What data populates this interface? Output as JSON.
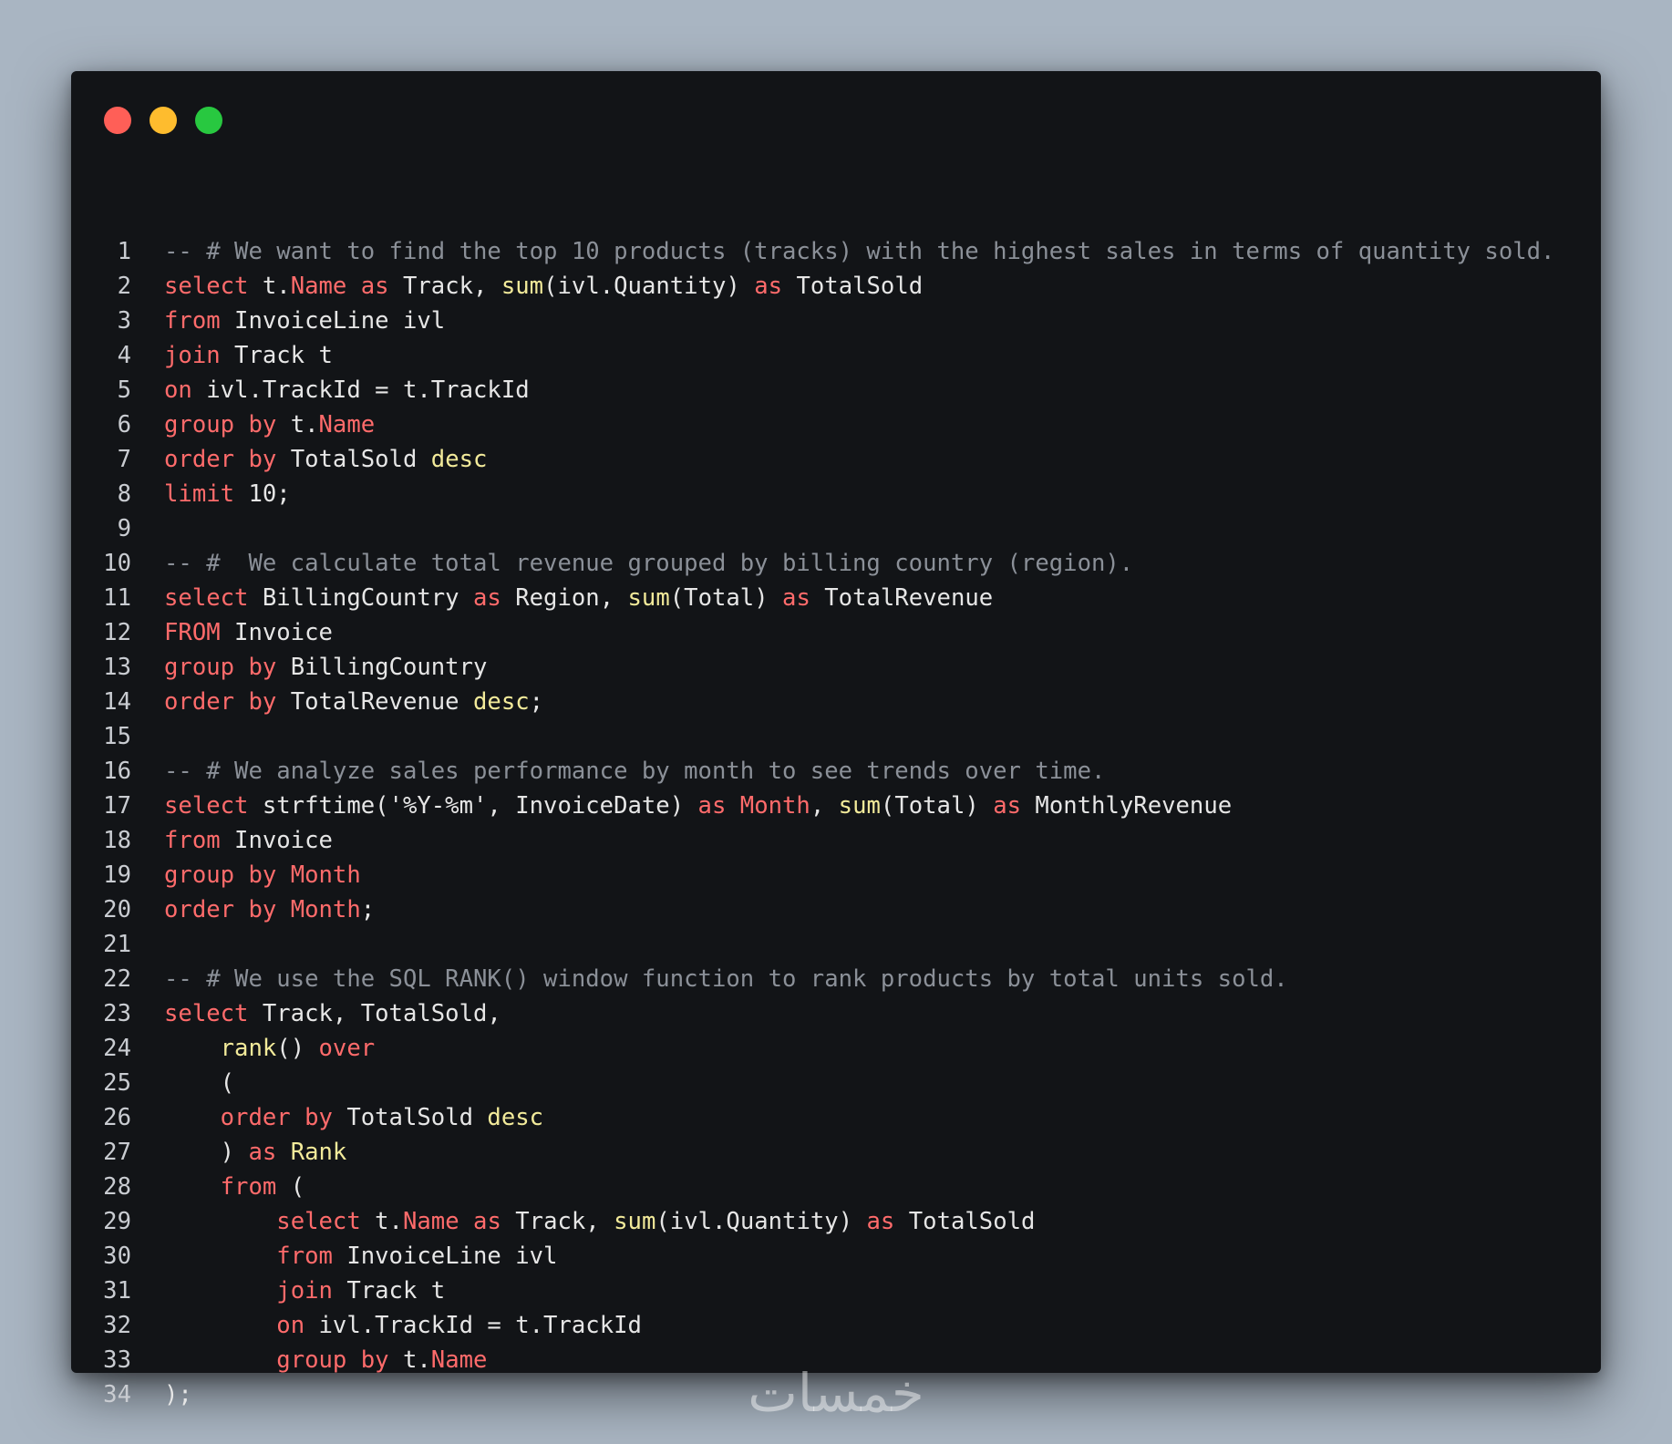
{
  "window": {
    "controls": [
      "close",
      "minimize",
      "maximize"
    ],
    "colors": {
      "close": "#ff5f57",
      "minimize": "#febc2e",
      "maximize": "#28c840",
      "background": "#121417",
      "keyword": "#ff6b6b",
      "function": "#f2ea9a",
      "comment": "#8b9098"
    }
  },
  "code": {
    "language": "sql",
    "lines": [
      [
        [
          "c",
          "-- # We want to find the top 10 products (tracks) with the highest sales in terms of quantity sold."
        ]
      ],
      [
        [
          "k",
          "select"
        ],
        [
          "s",
          " t."
        ],
        [
          "k",
          "Name"
        ],
        [
          "s",
          " "
        ],
        [
          "k",
          "as"
        ],
        [
          "s",
          " Track, "
        ],
        [
          "f",
          "sum"
        ],
        [
          "s",
          "(ivl.Quantity) "
        ],
        [
          "k",
          "as"
        ],
        [
          "s",
          " TotalSold"
        ]
      ],
      [
        [
          "k",
          "from"
        ],
        [
          "s",
          " InvoiceLine ivl"
        ]
      ],
      [
        [
          "k",
          "join"
        ],
        [
          "s",
          " Track t"
        ]
      ],
      [
        [
          "k",
          "on"
        ],
        [
          "s",
          " ivl.TrackId = t.TrackId"
        ]
      ],
      [
        [
          "k",
          "group by"
        ],
        [
          "s",
          " t."
        ],
        [
          "k",
          "Name"
        ]
      ],
      [
        [
          "k",
          "order by"
        ],
        [
          "s",
          " TotalSold "
        ],
        [
          "f",
          "desc"
        ]
      ],
      [
        [
          "k",
          "limit"
        ],
        [
          "s",
          " 10;"
        ]
      ],
      [],
      [
        [
          "c",
          "-- #  We calculate total revenue grouped by billing country (region)."
        ]
      ],
      [
        [
          "k",
          "select"
        ],
        [
          "s",
          " BillingCountry "
        ],
        [
          "k",
          "as"
        ],
        [
          "s",
          " Region, "
        ],
        [
          "f",
          "sum"
        ],
        [
          "s",
          "(Total) "
        ],
        [
          "k",
          "as"
        ],
        [
          "s",
          " TotalRevenue"
        ]
      ],
      [
        [
          "k",
          "FROM"
        ],
        [
          "s",
          " Invoice"
        ]
      ],
      [
        [
          "k",
          "group by"
        ],
        [
          "s",
          " BillingCountry"
        ]
      ],
      [
        [
          "k",
          "order by"
        ],
        [
          "s",
          " TotalRevenue "
        ],
        [
          "f",
          "desc"
        ],
        [
          "s",
          ";"
        ]
      ],
      [],
      [
        [
          "c",
          "-- # We analyze sales performance by month to see trends over time."
        ]
      ],
      [
        [
          "k",
          "select"
        ],
        [
          "s",
          " strftime('%Y-%m', InvoiceDate) "
        ],
        [
          "k",
          "as"
        ],
        [
          "s",
          " "
        ],
        [
          "k",
          "Month"
        ],
        [
          "s",
          ", "
        ],
        [
          "f",
          "sum"
        ],
        [
          "s",
          "(Total) "
        ],
        [
          "k",
          "as"
        ],
        [
          "s",
          " MonthlyRevenue"
        ]
      ],
      [
        [
          "k",
          "from"
        ],
        [
          "s",
          " Invoice"
        ]
      ],
      [
        [
          "k",
          "group by"
        ],
        [
          "s",
          " "
        ],
        [
          "k",
          "Month"
        ]
      ],
      [
        [
          "k",
          "order by"
        ],
        [
          "s",
          " "
        ],
        [
          "k",
          "Month"
        ],
        [
          "s",
          ";"
        ]
      ],
      [],
      [
        [
          "c",
          "-- # We use the SQL RANK() window function to rank products by total units sold."
        ]
      ],
      [
        [
          "k",
          "select"
        ],
        [
          "s",
          " Track, TotalSold,"
        ]
      ],
      [
        [
          "s",
          "    "
        ],
        [
          "f",
          "rank"
        ],
        [
          "s",
          "() "
        ],
        [
          "k",
          "over"
        ]
      ],
      [
        [
          "s",
          "    ("
        ]
      ],
      [
        [
          "s",
          "    "
        ],
        [
          "k",
          "order by"
        ],
        [
          "s",
          " TotalSold "
        ],
        [
          "f",
          "desc"
        ]
      ],
      [
        [
          "s",
          "    ) "
        ],
        [
          "k",
          "as"
        ],
        [
          "s",
          " "
        ],
        [
          "f",
          "Rank"
        ]
      ],
      [
        [
          "s",
          "    "
        ],
        [
          "k",
          "from"
        ],
        [
          "s",
          " ("
        ]
      ],
      [
        [
          "s",
          "        "
        ],
        [
          "k",
          "select"
        ],
        [
          "s",
          " t."
        ],
        [
          "k",
          "Name"
        ],
        [
          "s",
          " "
        ],
        [
          "k",
          "as"
        ],
        [
          "s",
          " Track, "
        ],
        [
          "f",
          "sum"
        ],
        [
          "s",
          "(ivl.Quantity) "
        ],
        [
          "k",
          "as"
        ],
        [
          "s",
          " TotalSold"
        ]
      ],
      [
        [
          "s",
          "        "
        ],
        [
          "k",
          "from"
        ],
        [
          "s",
          " InvoiceLine ivl"
        ]
      ],
      [
        [
          "s",
          "        "
        ],
        [
          "k",
          "join"
        ],
        [
          "s",
          " Track t"
        ]
      ],
      [
        [
          "s",
          "        "
        ],
        [
          "k",
          "on"
        ],
        [
          "s",
          " ivl.TrackId = t.TrackId"
        ]
      ],
      [
        [
          "s",
          "        "
        ],
        [
          "k",
          "group by"
        ],
        [
          "s",
          " t."
        ],
        [
          "k",
          "Name"
        ]
      ],
      [
        [
          "s",
          ");"
        ]
      ]
    ]
  },
  "watermark": "خمسات"
}
